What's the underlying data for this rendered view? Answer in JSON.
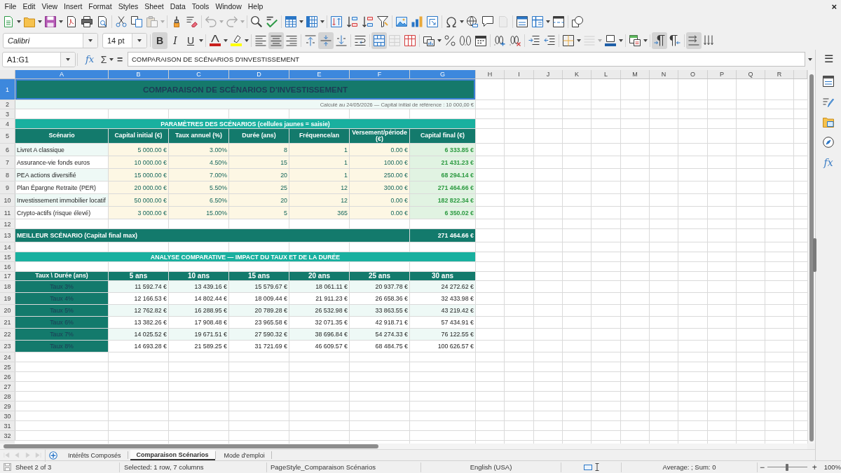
{
  "menu_bar": {
    "items": [
      "File",
      "Edit",
      "View",
      "Insert",
      "Format",
      "Styles",
      "Sheet",
      "Data",
      "Tools",
      "Window",
      "Help"
    ],
    "close_label": "×"
  },
  "standard_toolbar": {
    "paste": {
      "disabled": true
    },
    "undo": {
      "disabled": true
    },
    "redo": {
      "disabled": true
    },
    "header_footer": {
      "disabled": true
    }
  },
  "formatting_toolbar": {
    "font_name": "Calibri",
    "font_size": "14 pt",
    "bold": {
      "label": "B",
      "pressed": true
    },
    "italic": {
      "label": "I",
      "pressed": false
    },
    "underline": {
      "label": "U",
      "pressed": false
    },
    "horizontal_align": [
      {
        "selected": false
      },
      {
        "selected": true
      },
      {
        "selected": false
      }
    ],
    "vertical_align": [
      {
        "selected": false
      },
      {
        "selected": true
      },
      {
        "selected": false
      }
    ],
    "merge_and_center": {
      "pressed": true
    },
    "merge_cells": {
      "disabled": true
    },
    "border_style": {
      "disabled": true
    },
    "text_direction": [
      {
        "selected": true
      },
      {
        "selected": false
      }
    ],
    "text_flow": [
      {
        "selected": true
      },
      {
        "selected": false
      }
    ]
  },
  "formula_bar": {
    "name_box": "A1:G1",
    "function_wizard": "fx",
    "sum": "Σ",
    "formula": "=",
    "content": "COMPARAISON DE SCÉNARIOS D'INVESTISSEMENT"
  },
  "sidebar": {
    "menu": "☰",
    "functions": "fx"
  },
  "sheet": {
    "columns": [
      {
        "label": "A",
        "selected": true
      },
      {
        "label": "B",
        "selected": true
      },
      {
        "label": "C",
        "selected": true
      },
      {
        "label": "D",
        "selected": true
      },
      {
        "label": "E",
        "selected": true
      },
      {
        "label": "F",
        "selected": true
      },
      {
        "label": "G",
        "selected": true
      },
      {
        "label": "H",
        "selected": false
      },
      {
        "label": "I",
        "selected": false
      },
      {
        "label": "J",
        "selected": false
      },
      {
        "label": "K",
        "selected": false
      },
      {
        "label": "L",
        "selected": false
      },
      {
        "label": "M",
        "selected": false
      },
      {
        "label": "N",
        "selected": false
      },
      {
        "label": "O",
        "selected": false
      },
      {
        "label": "P",
        "selected": false
      },
      {
        "label": "Q",
        "selected": false
      },
      {
        "label": "R",
        "selected": false
      }
    ],
    "rows": [
      {
        "number": "1",
        "selected": true,
        "kind": "title",
        "text": "COMPARAISON DE SCÉNARIOS D'INVESTISSEMENT"
      },
      {
        "number": "2",
        "selected": false,
        "kind": "note",
        "text": "Calculé au 24/05/2026 — Capital initial de référence : 10 000,00 €"
      },
      {
        "number": "3",
        "selected": false,
        "kind": "empty"
      },
      {
        "number": "4",
        "selected": false,
        "kind": "section",
        "text": "PARAMÈTRES DES SCÉNARIOS (cellules jaunes = saisie)"
      },
      {
        "number": "5",
        "selected": false,
        "kind": "header",
        "cells": [
          "Scénario",
          "Capital initial (€)",
          "Taux annuel (%)",
          "Durée (ans)",
          "Fréquence/an",
          "Versement/période (€)",
          "Capital final (€)"
        ]
      },
      {
        "number": "6",
        "selected": false,
        "kind": "scenario",
        "cells": [
          "Livret A classique",
          "5 000.00 €",
          "3.00%",
          "8",
          "1",
          "0.00 €",
          "6 333.85 €"
        ]
      },
      {
        "number": "7",
        "selected": false,
        "kind": "scenario",
        "cells": [
          "Assurance-vie fonds euros",
          "10 000.00 €",
          "4.50%",
          "15",
          "1",
          "100.00 €",
          "21 431.23 €"
        ]
      },
      {
        "number": "8",
        "selected": false,
        "kind": "scenario",
        "cells": [
          "PEA actions diversifié",
          "15 000.00 €",
          "7.00%",
          "20",
          "1",
          "250.00 €",
          "68 294.14 €"
        ]
      },
      {
        "number": "9",
        "selected": false,
        "kind": "scenario",
        "cells": [
          "Plan Épargne Retraite (PER)",
          "20 000.00 €",
          "5.50%",
          "25",
          "12",
          "300.00 €",
          "271 464.66 €"
        ]
      },
      {
        "number": "10",
        "selected": false,
        "kind": "scenario",
        "cells": [
          "Investissement immobilier locatif",
          "50 000.00 €",
          "6.50%",
          "20",
          "12",
          "0.00 €",
          "182 822.34 €"
        ]
      },
      {
        "number": "11",
        "selected": false,
        "kind": "scenario",
        "cells": [
          "Crypto-actifs (risque élevé)",
          "3 000.00 €",
          "15.00%",
          "5",
          "365",
          "0.00 €",
          "6 350.02 €"
        ]
      },
      {
        "number": "12",
        "selected": false,
        "kind": "empty"
      },
      {
        "number": "13",
        "selected": false,
        "kind": "best",
        "label": "MEILLEUR SCÉNARIO (Capital final max)",
        "value": "271 464.66 €"
      },
      {
        "number": "14",
        "selected": false,
        "kind": "empty"
      },
      {
        "number": "15",
        "selected": false,
        "kind": "section",
        "text": "ANALYSE COMPARATIVE — IMPACT DU TAUX ET DE LA DURÉE"
      },
      {
        "number": "16",
        "selected": false,
        "kind": "empty"
      },
      {
        "number": "17",
        "selected": false,
        "kind": "matrix_header",
        "cells": [
          "Taux \\ Durée (ans)",
          "5 ans",
          "10 ans",
          "15 ans",
          "20 ans",
          "25 ans",
          "30 ans"
        ]
      },
      {
        "number": "18",
        "selected": false,
        "kind": "matrix",
        "cells": [
          "Taux 3%",
          "11 592.74 €",
          "13 439.16 €",
          "15 579.67 €",
          "18 061.11 €",
          "20 937.78 €",
          "24 272.62 €"
        ]
      },
      {
        "number": "19",
        "selected": false,
        "kind": "matrix",
        "cells": [
          "Taux 4%",
          "12 166.53 €",
          "14 802.44 €",
          "18 009.44 €",
          "21 911.23 €",
          "26 658.36 €",
          "32 433.98 €"
        ]
      },
      {
        "number": "20",
        "selected": false,
        "kind": "matrix",
        "cells": [
          "Taux 5%",
          "12 762.82 €",
          "16 288.95 €",
          "20 789.28 €",
          "26 532.98 €",
          "33 863.55 €",
          "43 219.42 €"
        ]
      },
      {
        "number": "21",
        "selected": false,
        "kind": "matrix",
        "cells": [
          "Taux 6%",
          "13 382.26 €",
          "17 908.48 €",
          "23 965.58 €",
          "32 071.35 €",
          "42 918.71 €",
          "57 434.91 €"
        ]
      },
      {
        "number": "22",
        "selected": false,
        "kind": "matrix",
        "cells": [
          "Taux 7%",
          "14 025.52 €",
          "19 671.51 €",
          "27 590.32 €",
          "38 696.84 €",
          "54 274.33 €",
          "76 122.55 €"
        ]
      },
      {
        "number": "23",
        "selected": false,
        "kind": "matrix",
        "cells": [
          "Taux 8%",
          "14 693.28 €",
          "21 589.25 €",
          "31 721.69 €",
          "46 609.57 €",
          "68 484.75 €",
          "100 626.57 €"
        ]
      },
      {
        "number": "24",
        "selected": false,
        "kind": "empty"
      },
      {
        "number": "25",
        "selected": false,
        "kind": "empty"
      },
      {
        "number": "26",
        "selected": false,
        "kind": "empty"
      },
      {
        "number": "27",
        "selected": false,
        "kind": "empty"
      },
      {
        "number": "28",
        "selected": false,
        "kind": "empty"
      },
      {
        "number": "29",
        "selected": false,
        "kind": "empty"
      },
      {
        "number": "30",
        "selected": false,
        "kind": "empty"
      },
      {
        "number": "31",
        "selected": false,
        "kind": "empty"
      },
      {
        "number": "32",
        "selected": false,
        "kind": "empty"
      }
    ]
  },
  "sheet_navigation": [
    {
      "disabled": true
    },
    {
      "disabled": true
    },
    {
      "disabled": true
    },
    {
      "disabled": true
    }
  ],
  "sheet_tabs": [
    {
      "label": "Intérêts Composés",
      "selected": false
    },
    {
      "label": "Comparaison Scénarios",
      "selected": true
    },
    {
      "label": "Mode d'emploi",
      "selected": false
    }
  ],
  "status_bar": {
    "sheet_position": "Sheet 2 of 3",
    "selection": "Selected: 1 row, 7 columns",
    "page_style": "PageStyle_Comparaison Scénarios",
    "language": "English (USA)",
    "statistics": "Average: ; Sum: 0",
    "zoom_out": "−",
    "zoom": {
      "level": 0.5
    },
    "zoom_in": "+",
    "zoom_reading": "100%"
  }
}
